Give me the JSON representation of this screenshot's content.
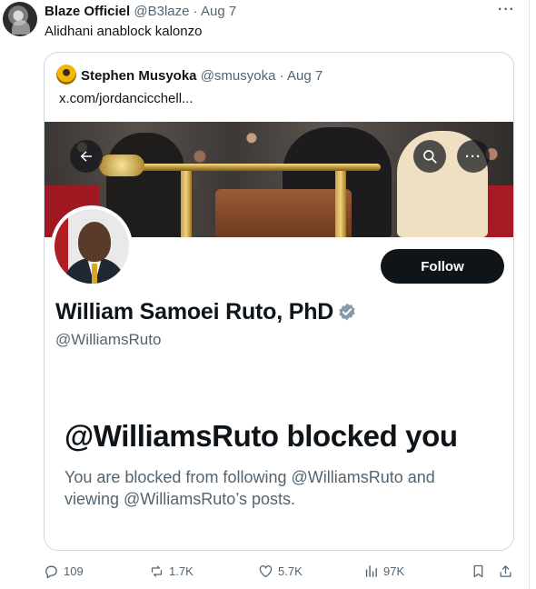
{
  "tweet": {
    "author_name": "Blaze Officiel",
    "author_handle": "@B3laze",
    "separator": "·",
    "date": "Aug 7",
    "text": "Alidhani anablock kalonzo"
  },
  "quoted": {
    "author_name": "Stephen Musyoka",
    "author_handle": "@smusyoka",
    "separator": "·",
    "date": "Aug 7",
    "text": "x.com/jordancicchell...",
    "profile": {
      "display_name": "William Samoei Ruto, PhD",
      "handle": "@WilliamsRuto",
      "follow_label": "Follow",
      "blocked_title": "@WilliamsRuto blocked you",
      "blocked_desc": "You are blocked from following @WilliamsRuto and viewing @WilliamsRuto’s posts."
    }
  },
  "actions": {
    "replies": "109",
    "reposts": "1.7K",
    "likes": "5.7K",
    "views": "97K"
  },
  "icons": {
    "more": "more-horizontal-icon",
    "back": "arrow-left-icon",
    "search": "search-icon",
    "verified": "verified-badge-icon",
    "reply": "reply-icon",
    "repost": "repost-icon",
    "like": "heart-icon",
    "views": "views-bar-chart-icon",
    "bookmark": "bookmark-icon",
    "share": "share-icon"
  },
  "colors": {
    "text": "#0f1419",
    "muted": "#536471",
    "border": "#cfd9de",
    "follow_bg": "#0f1419",
    "verified": "#829aab"
  }
}
